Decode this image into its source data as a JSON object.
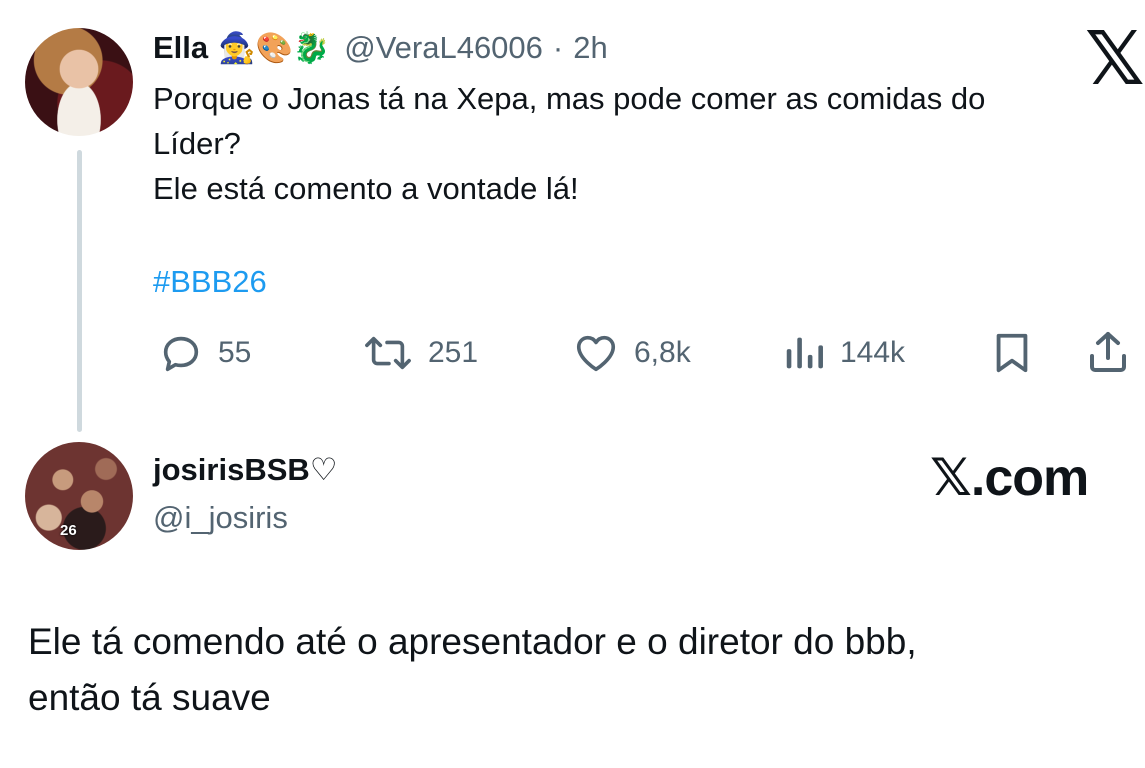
{
  "tweet": {
    "author_name": "Ella",
    "author_emojis": "🧙‍♀️🎨🐉",
    "handle": "@VeraL46006",
    "separator": "·",
    "time": "2h",
    "x_logo": "𝕏",
    "text_line1": "Porque o Jonas tá na Xepa, mas pode comer as comidas do",
    "text_line2": "Líder?",
    "text_line3": "Ele está comento a vontade lá!",
    "hashtag": "#BBB26",
    "actions": {
      "replies": "55",
      "retweets": "251",
      "likes": "6,8k",
      "views": "144k"
    },
    "icons": [
      "reply-icon",
      "retweet-icon",
      "like-icon",
      "views-icon",
      "bookmark-icon",
      "share-icon"
    ]
  },
  "reply": {
    "author_name": "josirisBSB",
    "heart": "♡",
    "handle": "@i_josiris",
    "avatar_badge": "26",
    "text_line1": "Ele tá comendo até o apresentador e o diretor do bbb,",
    "text_line2": "então tá suave",
    "brand_logo": "𝕏",
    "brand_text": ".com"
  },
  "colors": {
    "text": "#0f1419",
    "secondary": "#536471",
    "link": "#1d9bf0",
    "thread_line": "#cfd9de"
  }
}
